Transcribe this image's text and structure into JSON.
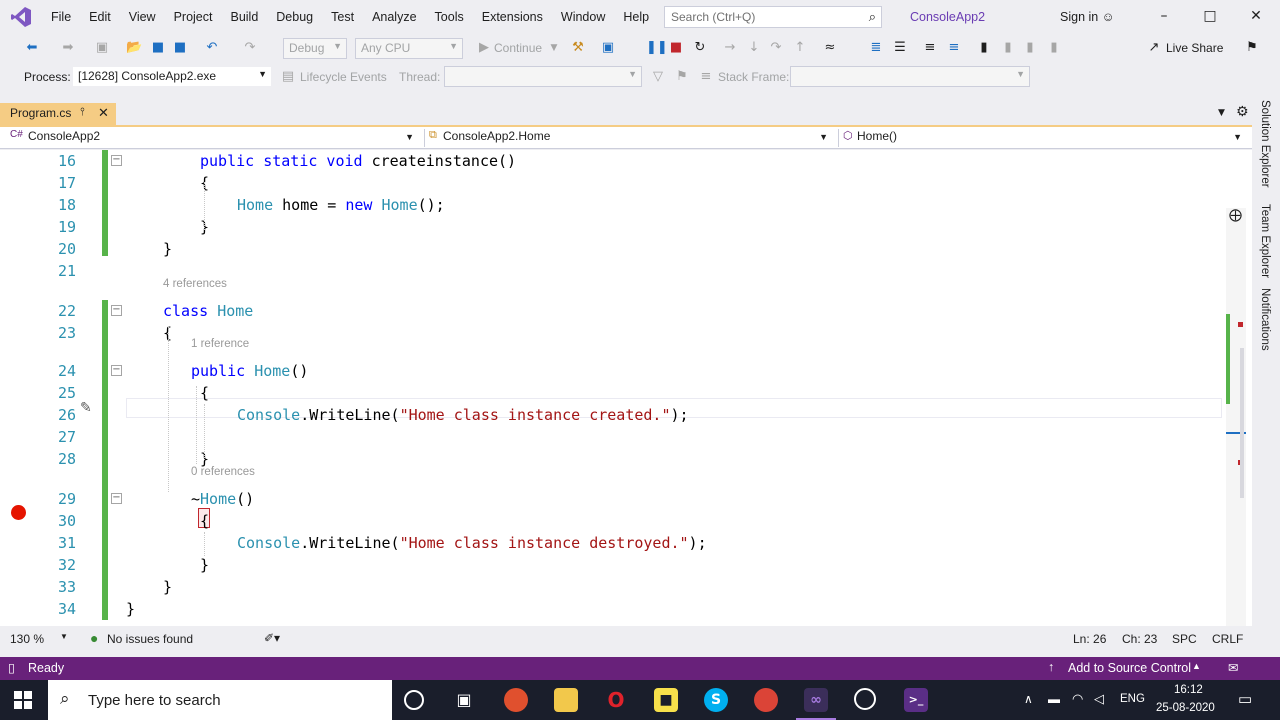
{
  "menu": [
    "File",
    "Edit",
    "View",
    "Project",
    "Build",
    "Debug",
    "Test",
    "Analyze",
    "Tools",
    "Extensions",
    "Window",
    "Help"
  ],
  "search": {
    "placeholder": "Search (Ctrl+Q)"
  },
  "solution_name": "ConsoleApp2",
  "signin": "Sign in",
  "toolbar": {
    "config": "Debug",
    "platform": "Any CPU",
    "continue": "Continue",
    "live_share": "Live Share",
    "process_label": "Process:",
    "process_value": "[12628] ConsoleApp2.exe",
    "lifecycle": "Lifecycle Events",
    "thread": "Thread:",
    "stack_frame": "Stack Frame:"
  },
  "tab": {
    "label": "Program.cs"
  },
  "nav": {
    "project": "ConsoleApp2",
    "type": "ConsoleApp2.Home",
    "member": "Home()"
  },
  "code": {
    "lines": [
      {
        "n": "16",
        "segments": [
          {
            "t": "public static void ",
            "c": "kw"
          },
          {
            "t": "createinstance()",
            "c": ""
          }
        ]
      },
      {
        "n": "17",
        "segments": [
          {
            "t": "{",
            "c": ""
          }
        ]
      },
      {
        "n": "18",
        "segments": [
          {
            "t": "Home",
            "c": "ty"
          },
          {
            "t": " home = ",
            "c": ""
          },
          {
            "t": "new ",
            "c": "kw"
          },
          {
            "t": "Home",
            "c": "ty"
          },
          {
            "t": "();",
            "c": ""
          }
        ]
      },
      {
        "n": "19",
        "segments": [
          {
            "t": "}",
            "c": ""
          }
        ]
      },
      {
        "n": "20",
        "segments": [
          {
            "t": "}",
            "c": ""
          }
        ]
      },
      {
        "n": "21",
        "segments": []
      },
      {
        "n": "22",
        "segments": [
          {
            "t": "class ",
            "c": "kw"
          },
          {
            "t": "Home",
            "c": "ty"
          }
        ]
      },
      {
        "n": "23",
        "segments": [
          {
            "t": "{",
            "c": ""
          }
        ]
      },
      {
        "n": "24",
        "segments": [
          {
            "t": "public ",
            "c": "kw"
          },
          {
            "t": "Home",
            "c": "ty"
          },
          {
            "t": "()",
            "c": ""
          }
        ]
      },
      {
        "n": "25",
        "segments": [
          {
            "t": "{",
            "c": ""
          }
        ]
      },
      {
        "n": "26",
        "segments": [
          {
            "t": "Console",
            "c": "ty"
          },
          {
            "t": ".WriteLine(",
            "c": ""
          },
          {
            "t": "\"Home class instance created.\"",
            "c": "str"
          },
          {
            "t": ");",
            "c": ""
          }
        ]
      },
      {
        "n": "27",
        "segments": []
      },
      {
        "n": "28",
        "segments": [
          {
            "t": "}",
            "c": ""
          }
        ]
      },
      {
        "n": "29",
        "segments": [
          {
            "t": "~",
            "c": ""
          },
          {
            "t": "Home",
            "c": "ty"
          },
          {
            "t": "()",
            "c": ""
          }
        ]
      },
      {
        "n": "30",
        "segments": [
          {
            "t": "{",
            "c": ""
          }
        ]
      },
      {
        "n": "31",
        "segments": [
          {
            "t": "Console",
            "c": "ty"
          },
          {
            "t": ".WriteLine(",
            "c": ""
          },
          {
            "t": "\"Home class instance destroyed.\"",
            "c": "str"
          },
          {
            "t": ");",
            "c": ""
          }
        ]
      },
      {
        "n": "32",
        "segments": [
          {
            "t": "}",
            "c": ""
          }
        ]
      },
      {
        "n": "33",
        "segments": [
          {
            "t": "}",
            "c": ""
          }
        ]
      },
      {
        "n": "34",
        "segments": [
          {
            "t": "}",
            "c": ""
          }
        ]
      }
    ],
    "lens_4": "4 references",
    "lens_1": "1 reference",
    "lens_0": "0 references"
  },
  "editor_status": {
    "zoom": "130 %",
    "issues": "No issues found",
    "ln": "Ln: 26",
    "ch": "Ch: 23",
    "spc": "SPC",
    "crlf": "CRLF"
  },
  "side_tabs": [
    "Solution Explorer",
    "Team Explorer",
    "Notifications"
  ],
  "statusbar": {
    "ready": "Ready",
    "source_control": "Add to Source Control"
  },
  "taskbar": {
    "search": "Type here to search",
    "lang": "ENG",
    "time": "16:12",
    "date": "25-08-2020"
  },
  "colors": {
    "accent": "#68217A",
    "tab": "#F5CC84",
    "breakpoint": "#E51400",
    "changed": "#57B34A"
  }
}
